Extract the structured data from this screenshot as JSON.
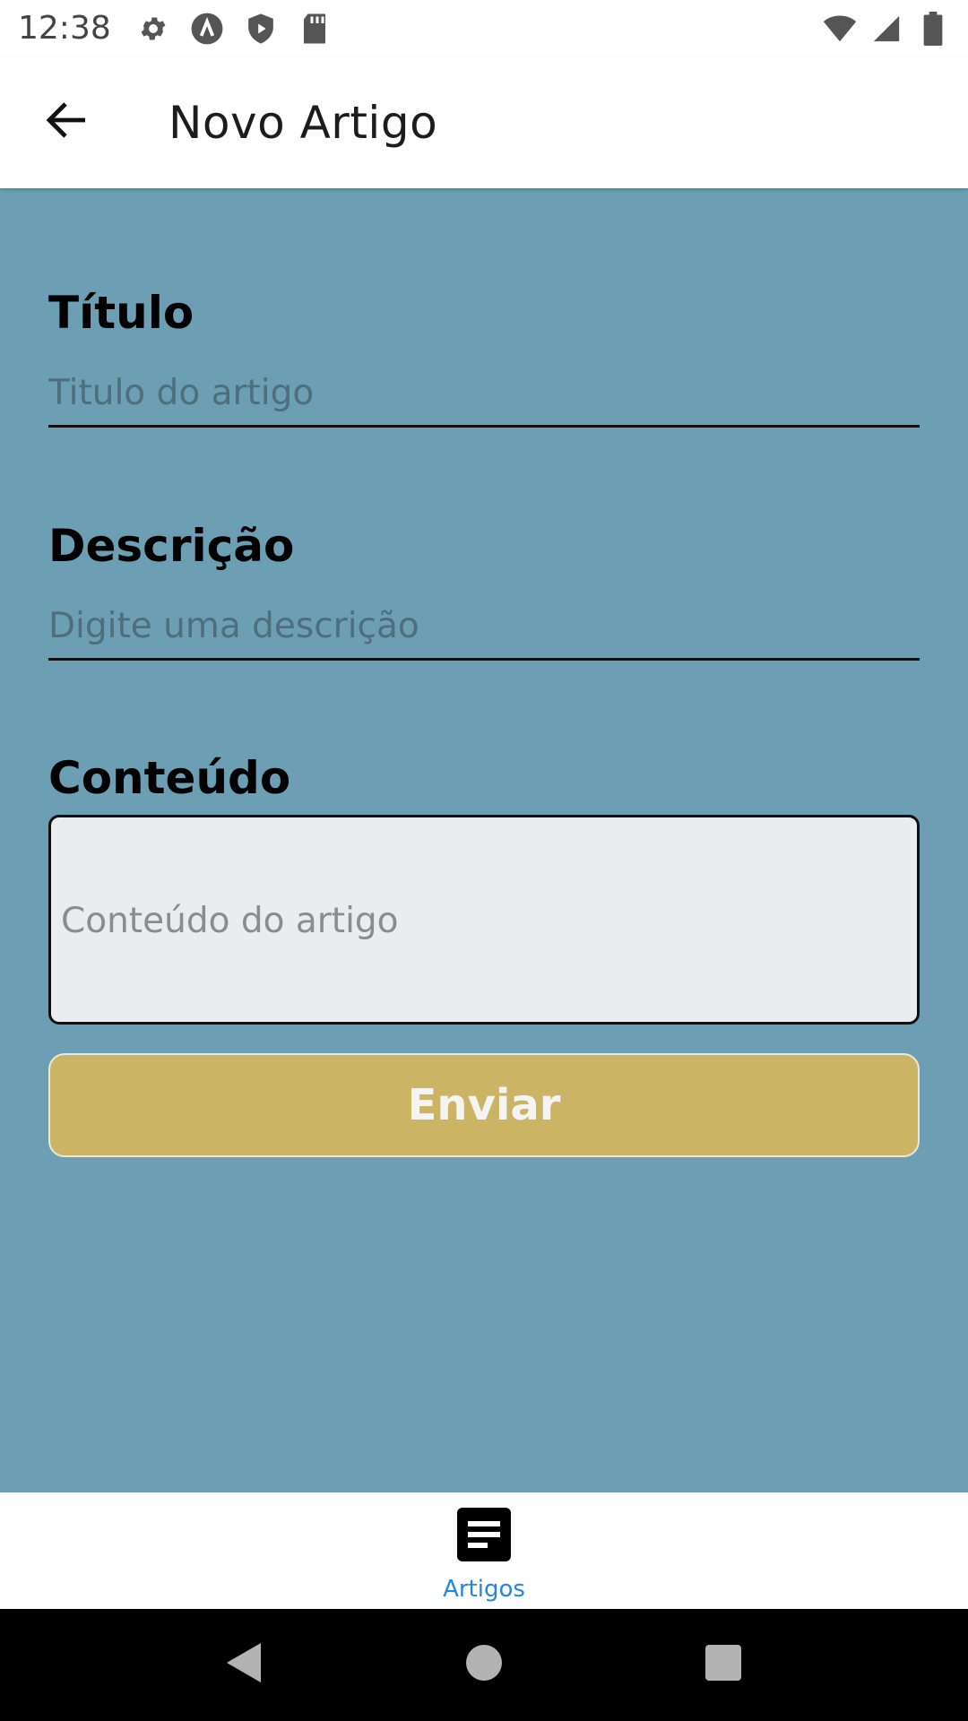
{
  "status_bar": {
    "time": "12:38",
    "left_icons": [
      "gear-icon",
      "a-circle-icon",
      "shield-play-icon",
      "sd-card-icon"
    ],
    "right_icons": [
      "wifi-icon",
      "signal-icon",
      "battery-icon"
    ]
  },
  "app_bar": {
    "title": "Novo Artigo",
    "back_icon": "arrow-left-icon"
  },
  "form": {
    "title_label": "Título",
    "title_placeholder": "Titulo do artigo",
    "description_label": "Descrição",
    "description_placeholder": "Digite uma descrição",
    "content_label": "Conteúdo",
    "content_placeholder": "Conteúdo do artigo",
    "submit_label": "Enviar"
  },
  "bottom_nav": {
    "items": [
      {
        "label": "Artigos",
        "icon": "article-icon",
        "active": true
      }
    ]
  },
  "system_nav": [
    "back-triangle-icon",
    "home-circle-icon",
    "recents-square-icon"
  ],
  "colors": {
    "content_bg": "#6d9fb4",
    "button_bg": "#cbb565",
    "textarea_bg": "#ebecee",
    "nav_active": "#2486e3"
  }
}
